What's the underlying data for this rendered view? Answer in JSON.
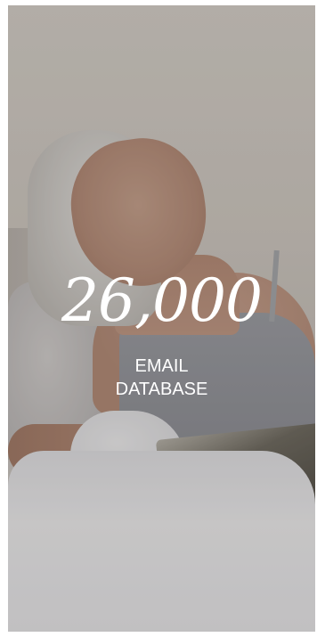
{
  "hero": {
    "number": "26,000",
    "label_line1": "EMAIL",
    "label_line2": "DATABASE",
    "image_alt": "Woman with gray hair lying in bed with a book"
  },
  "colors": {
    "text": "#ffffff",
    "overlay": "rgba(40,35,30,0.22)"
  }
}
